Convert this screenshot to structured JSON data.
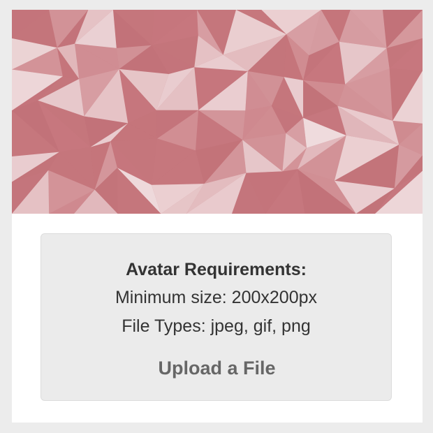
{
  "banner": {
    "base_color": "#c97a80",
    "highlight_color": "#f3e6e7"
  },
  "requirements": {
    "title": "Avatar Requirements:",
    "min_size": "Minimum size: 200x200px",
    "file_types": "File Types: jpeg, gif, png"
  },
  "upload": {
    "label": "Upload a File"
  }
}
